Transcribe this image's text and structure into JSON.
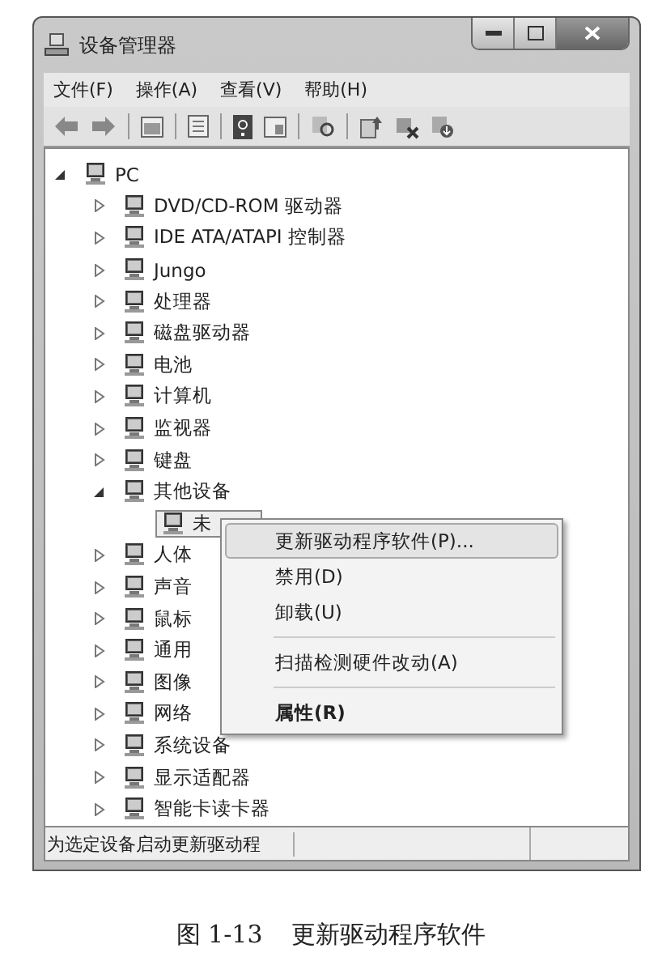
{
  "window": {
    "title": "设备管理器"
  },
  "menu": [
    "文件(F)",
    "操作(A)",
    "查看(V)",
    "帮助(H)"
  ],
  "tree": {
    "label": "PC",
    "expanded": true,
    "children": [
      {
        "label": "DVD/CD-ROM 驱动器",
        "expanded": false
      },
      {
        "label": "IDE ATA/ATAPI 控制器",
        "expanded": false
      },
      {
        "label": "Jungo",
        "expanded": false
      },
      {
        "label": "处理器",
        "expanded": false
      },
      {
        "label": "磁盘驱动器",
        "expanded": false
      },
      {
        "label": "电池",
        "expanded": false
      },
      {
        "label": "计算机",
        "expanded": false
      },
      {
        "label": "监视器",
        "expanded": false
      },
      {
        "label": "键盘",
        "expanded": false
      },
      {
        "label": "其他设备",
        "expanded": true,
        "children": [
          {
            "label": "未",
            "selected": true
          }
        ]
      },
      {
        "label": "人体",
        "expanded": false
      },
      {
        "label": "声音",
        "expanded": false
      },
      {
        "label": "鼠标",
        "expanded": false
      },
      {
        "label": "通用",
        "expanded": false
      },
      {
        "label": "图像",
        "expanded": false
      },
      {
        "label": "网络",
        "expanded": false
      },
      {
        "label": "系统设备",
        "expanded": false
      },
      {
        "label": "显示适配器",
        "expanded": false
      },
      {
        "label": "智能卡读卡器",
        "expanded": false
      }
    ]
  },
  "context_menu": {
    "items": [
      {
        "kind": "item",
        "label": "更新驱动程序软件(P)...",
        "selected": true,
        "bold": false
      },
      {
        "kind": "item",
        "label": "禁用(D)",
        "selected": false,
        "bold": false
      },
      {
        "kind": "item",
        "label": "卸载(U)",
        "selected": false,
        "bold": false
      },
      {
        "kind": "separator"
      },
      {
        "kind": "item",
        "label": "扫描检测硬件改动(A)",
        "selected": false,
        "bold": false
      },
      {
        "kind": "separator"
      },
      {
        "kind": "item",
        "label": "属性(R)",
        "selected": false,
        "bold": true
      }
    ]
  },
  "status_bar": {
    "text": "为选定设备启动更新驱动程"
  },
  "caption": {
    "number": "图 1-13",
    "text": "更新驱动程序软件"
  }
}
